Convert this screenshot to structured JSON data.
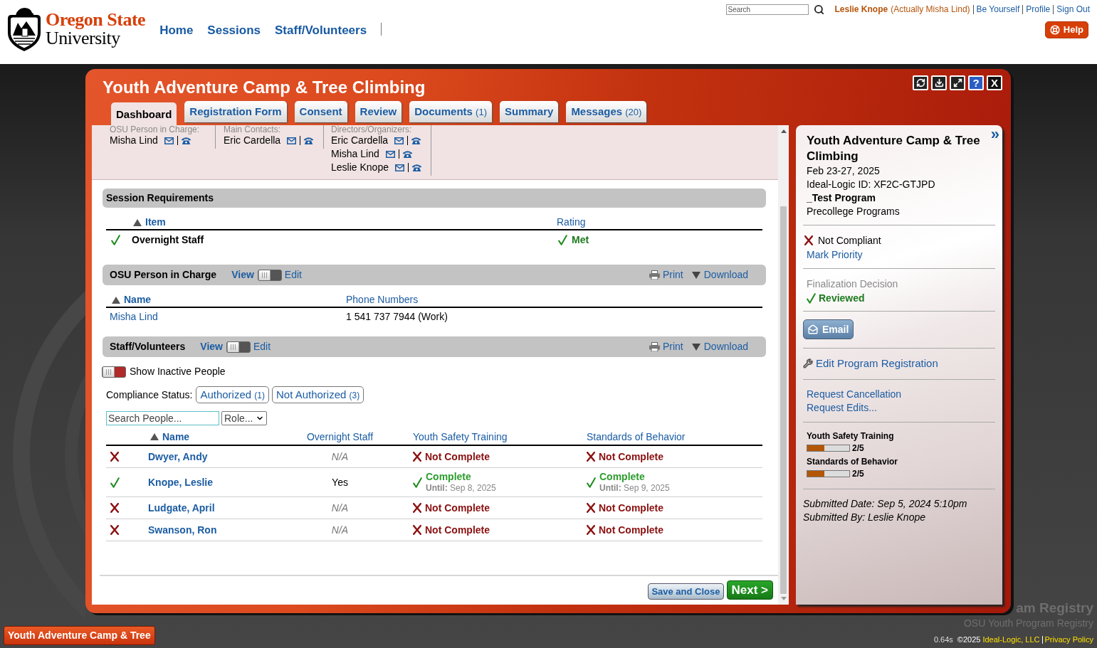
{
  "header": {
    "logo": {
      "line_1": "Oregon State",
      "line_2": "University"
    },
    "nav": [
      {
        "label": "Home"
      },
      {
        "label": "Sessions"
      },
      {
        "label": "Staff/Volunteers"
      }
    ],
    "search": {
      "placeholder": "Search"
    },
    "user": {
      "name": "Leslie Knope",
      "note": "(Actually Misha Lind)"
    },
    "user_links": [
      {
        "label": "Be Yourself"
      },
      {
        "label": "Profile"
      },
      {
        "label": "Sign Out"
      }
    ],
    "help_button": {
      "label": "Help"
    }
  },
  "dialog": {
    "title": "Youth Adventure Camp & Tree Climbing",
    "window_buttons": [
      {
        "kind": "refresh"
      },
      {
        "kind": "download"
      },
      {
        "kind": "expand"
      },
      {
        "kind": "help",
        "label": "?"
      },
      {
        "kind": "close",
        "label": "X"
      }
    ],
    "tabs": [
      {
        "label": "Dashboard",
        "selected": true
      },
      {
        "label": "Registration Form",
        "selected": false
      },
      {
        "label": "Consent",
        "selected": false
      },
      {
        "label": "Review",
        "selected": false
      },
      {
        "label": "Documents",
        "count": "(1)",
        "selected": false
      },
      {
        "label": "Summary",
        "selected": false
      },
      {
        "label": "Messages",
        "count": "(20)",
        "selected": false
      }
    ],
    "contacts": [
      {
        "label": "OSU Person in Charge:",
        "people": [
          {
            "name": "Misha Lind"
          }
        ]
      },
      {
        "label": "Main Contacts:",
        "people": [
          {
            "name": "Eric Cardella"
          }
        ]
      },
      {
        "label": "Directors/Organizers:",
        "people": [
          {
            "name": "Eric Cardella"
          },
          {
            "name": "Misha Lind"
          },
          {
            "name": "Leslie Knope"
          }
        ]
      }
    ],
    "session_requirements": {
      "title": "Session Requirements",
      "columns": [
        {
          "label": "Item",
          "sorted": true
        },
        {
          "label": "Rating",
          "sorted": false
        }
      ],
      "rows": [
        {
          "met": true,
          "item": "Overnight Staff",
          "rating": "Met"
        }
      ]
    },
    "person_in_charge": {
      "title": "OSU Person in Charge",
      "view_label": "View",
      "edit_label": "Edit",
      "edit_mode": false,
      "print_label": "Print",
      "download_label": "Download",
      "columns": [
        {
          "label": "Name",
          "sorted": true
        },
        {
          "label": "Phone Numbers",
          "sorted": false
        }
      ],
      "rows": [
        {
          "name": "Misha Lind",
          "phone": "1 541 737 7944 (Work)"
        }
      ]
    },
    "staff": {
      "title": "Staff/Volunteers",
      "view_label": "View",
      "edit_label": "Edit",
      "edit_mode": false,
      "print_label": "Print",
      "download_label": "Download",
      "show_inactive": {
        "label": "Show Inactive People",
        "on": false
      },
      "compliance": {
        "label": "Compliance Status:",
        "filters": [
          {
            "label": "Authorized",
            "count": "(1)"
          },
          {
            "label": "Not Authorized",
            "count": "(3)"
          }
        ]
      },
      "search": {
        "placeholder": "Search People..."
      },
      "role_select": {
        "value": "Role..."
      },
      "columns": [
        {
          "label": "Name",
          "sorted": true
        },
        {
          "label": "Overnight Staff",
          "sorted": false
        },
        {
          "label": "Youth Safety Training",
          "sorted": false
        },
        {
          "label": "Standards of Behavior",
          "sorted": false
        }
      ],
      "rows": [
        {
          "authorized": false,
          "name": "Dwyer, Andy",
          "overnight": {
            "value": "N/A",
            "applicable": false
          },
          "youth_safety": {
            "complete": false,
            "label": "Not Complete"
          },
          "standards": {
            "complete": false,
            "label": "Not Complete"
          }
        },
        {
          "authorized": true,
          "name": "Knope, Leslie",
          "overnight": {
            "value": "Yes",
            "applicable": true
          },
          "youth_safety": {
            "complete": true,
            "label": "Complete",
            "until": "**Until:** Sep 8, 2025"
          },
          "standards": {
            "complete": true,
            "label": "Complete",
            "until": "**Until:** Sep 9, 2025"
          }
        },
        {
          "authorized": false,
          "name": "Ludgate, April",
          "overnight": {
            "value": "N/A",
            "applicable": false
          },
          "youth_safety": {
            "complete": false,
            "label": "Not Complete"
          },
          "standards": {
            "complete": false,
            "label": "Not Complete"
          }
        },
        {
          "authorized": false,
          "name": "Swanson, Ron",
          "overnight": {
            "value": "N/A",
            "applicable": false
          },
          "youth_safety": {
            "complete": false,
            "label": "Not Complete"
          },
          "standards": {
            "complete": false,
            "label": "Not Complete"
          }
        }
      ]
    },
    "footer_buttons": [
      {
        "kind": "secondary",
        "label": "Save and Close"
      },
      {
        "kind": "primary",
        "label": "Next >"
      }
    ]
  },
  "summary_panel": {
    "collapse_label": "»",
    "title": "Youth Adventure Camp & Tree Climbing",
    "dates": "Feb 23-27, 2025",
    "program_id": "Ideal-Logic ID: XF2C-GTJPD",
    "program": "_Test Program",
    "department": "Precollege Programs",
    "compliance": {
      "compliant": false,
      "label": "Not Compliant"
    },
    "mark_priority": "Mark Priority",
    "finalization": {
      "label": "Finalization Decision",
      "reviewed": true,
      "value": "Reviewed"
    },
    "email_button": "Email",
    "edit_link": "Edit Program Registration",
    "request_links": [
      {
        "label": "Request Cancellation"
      },
      {
        "label": "Request Edits..."
      }
    ],
    "progress": [
      {
        "label": "Youth Safety Training",
        "level": 0.4,
        "reading": "2/5"
      },
      {
        "label": "Standards of Behavior",
        "level": 0.4,
        "reading": "2/5"
      }
    ],
    "submitted_date": "Submitted Date: Sep 5, 2024 5:10pm",
    "submitted_by": "Submitted By: Leslie Knope"
  },
  "taskbar": [
    {
      "label": "Youth Adventure Camp & Tree"
    }
  ],
  "background_text": [
    {
      "kind": "title",
      "text": "am Registry"
    },
    {
      "kind": "subtitle",
      "text": "OSU Youth Program Registry"
    }
  ],
  "footer": {
    "timing": "0.64s",
    "copyright": "©2025",
    "company": "Ideal-Logic, LLC",
    "privacy": "Privacy Policy"
  }
}
